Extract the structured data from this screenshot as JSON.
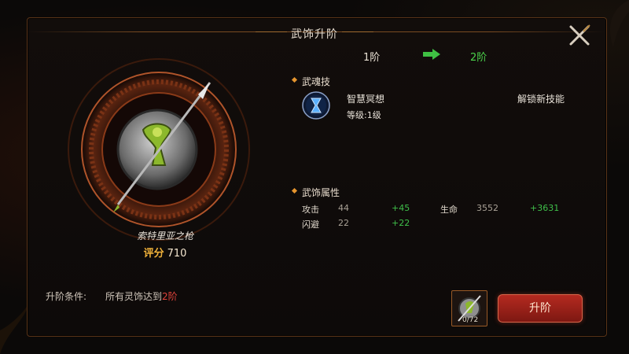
{
  "title": "武饰升阶",
  "tier": {
    "from": "1阶",
    "to": "2阶"
  },
  "weapon": {
    "name": "索特里亚之枪",
    "score_label": "评分",
    "score_value": "710"
  },
  "condition": {
    "label": "升阶条件:",
    "text": "所有灵饰达到",
    "highlight": "2阶"
  },
  "skill_section": {
    "heading": "武魂技",
    "skill_name": "智慧冥想",
    "skill_level": "等级:1级",
    "unlock_text": "解锁新技能"
  },
  "attr_section": {
    "heading": "武饰属性",
    "stats": [
      {
        "name": "攻击",
        "value": "44",
        "plus": "+45"
      },
      {
        "name": "生命",
        "value": "3552",
        "plus": "+3631"
      },
      {
        "name": "闪避",
        "value": "22",
        "plus": "+22"
      }
    ]
  },
  "material": {
    "count": "0/72"
  },
  "upgrade_button": "升阶",
  "colors": {
    "accent_green": "#4bd34b",
    "accent_red": "#e0433b",
    "gold": "#f0b23a",
    "button_red": "#b52a20"
  },
  "icons": [
    "close-icon",
    "arrow-right-icon",
    "hourglass-icon",
    "spear-icon",
    "diamond-icon"
  ]
}
